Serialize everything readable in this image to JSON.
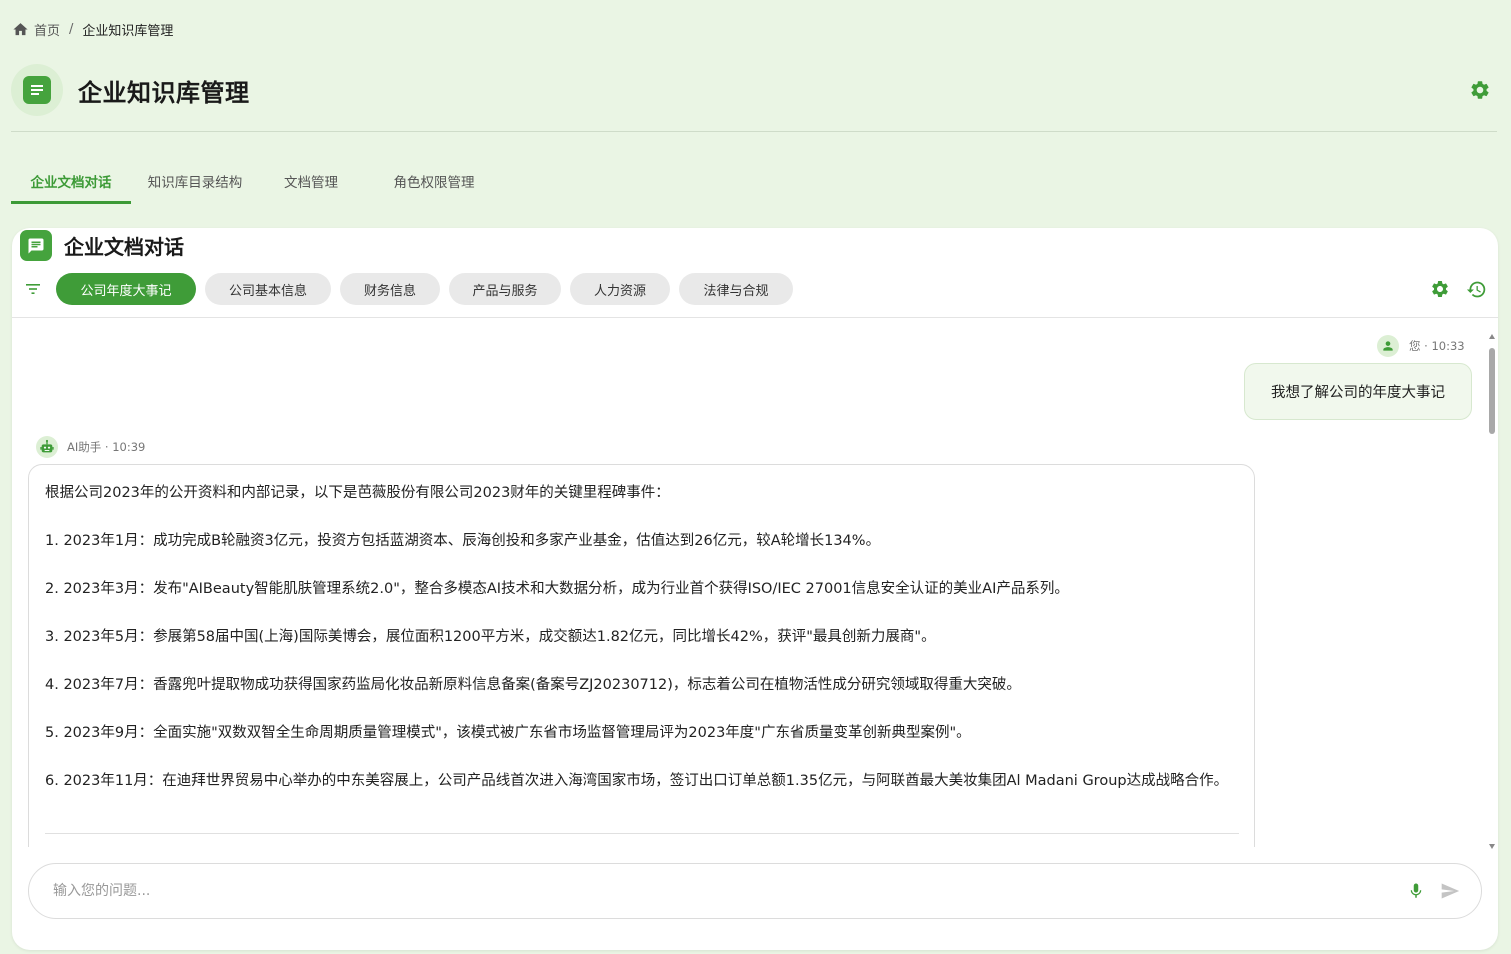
{
  "breadcrumb": {
    "home_label": "首页",
    "separator": "/",
    "current": "企业知识库管理"
  },
  "header": {
    "title": "企业知识库管理"
  },
  "tabs": [
    {
      "label": "企业文档对话",
      "active": true
    },
    {
      "label": "知识库目录结构",
      "active": false
    },
    {
      "label": "文档管理",
      "active": false
    },
    {
      "label": "角色权限管理",
      "active": false
    }
  ],
  "chat": {
    "title": "企业文档对话",
    "categories": [
      {
        "label": "公司年度大事记",
        "active": true
      },
      {
        "label": "公司基本信息",
        "active": false
      },
      {
        "label": "财务信息",
        "active": false
      },
      {
        "label": "产品与服务",
        "active": false
      },
      {
        "label": "人力资源",
        "active": false
      },
      {
        "label": "法律与合规",
        "active": false
      }
    ],
    "messages": {
      "user": {
        "meta": "您 · 10:33",
        "text": "我想了解公司的年度大事记"
      },
      "ai": {
        "meta": "AI助手 · 10:39",
        "paragraphs": [
          "根据公司2023年的公开资料和内部记录，以下是芭薇股份有限公司2023财年的关键里程碑事件：",
          "1. 2023年1月：成功完成B轮融资3亿元，投资方包括蓝湖资本、辰海创投和多家产业基金，估值达到26亿元，较A轮增长134%。",
          "2. 2023年3月：发布\"AIBeauty智能肌肤管理系统2.0\"，整合多模态AI技术和大数据分析，成为行业首个获得ISO/IEC 27001信息安全认证的美业AI产品系列。",
          "3. 2023年5月：参展第58届中国(上海)国际美博会，展位面积1200平方米，成交额达1.82亿元，同比增长42%，获评\"最具创新力展商\"。",
          "4. 2023年7月：香露兜叶提取物成功获得国家药监局化妆品新原料信息备案(备案号ZJ20230712)，标志着公司在植物活性成分研究领域取得重大突破。",
          "5. 2023年9月：全面实施\"双数双智全生命周期质量管理模式\"，该模式被广东省市场监督管理局评为2023年度\"广东省质量变革创新典型案例\"。",
          "6. 2023年11月：在迪拜世界贸易中心举办的中东美容展上，公司产品线首次进入海湾国家市场，签订出口订单总额1.35亿元，与阿联酋最大美妆集团Al Madani Group达成战略合作。"
        ]
      }
    },
    "input": {
      "placeholder": "输入您的问题..."
    }
  },
  "colors": {
    "accent": "#3f9c38",
    "page_bg": "#eaf5e4"
  },
  "icons": [
    "home-icon",
    "document-icon",
    "gear-icon",
    "chat-icon",
    "filter-icon",
    "history-icon",
    "user-icon",
    "robot-icon",
    "mic-icon",
    "send-icon"
  ]
}
